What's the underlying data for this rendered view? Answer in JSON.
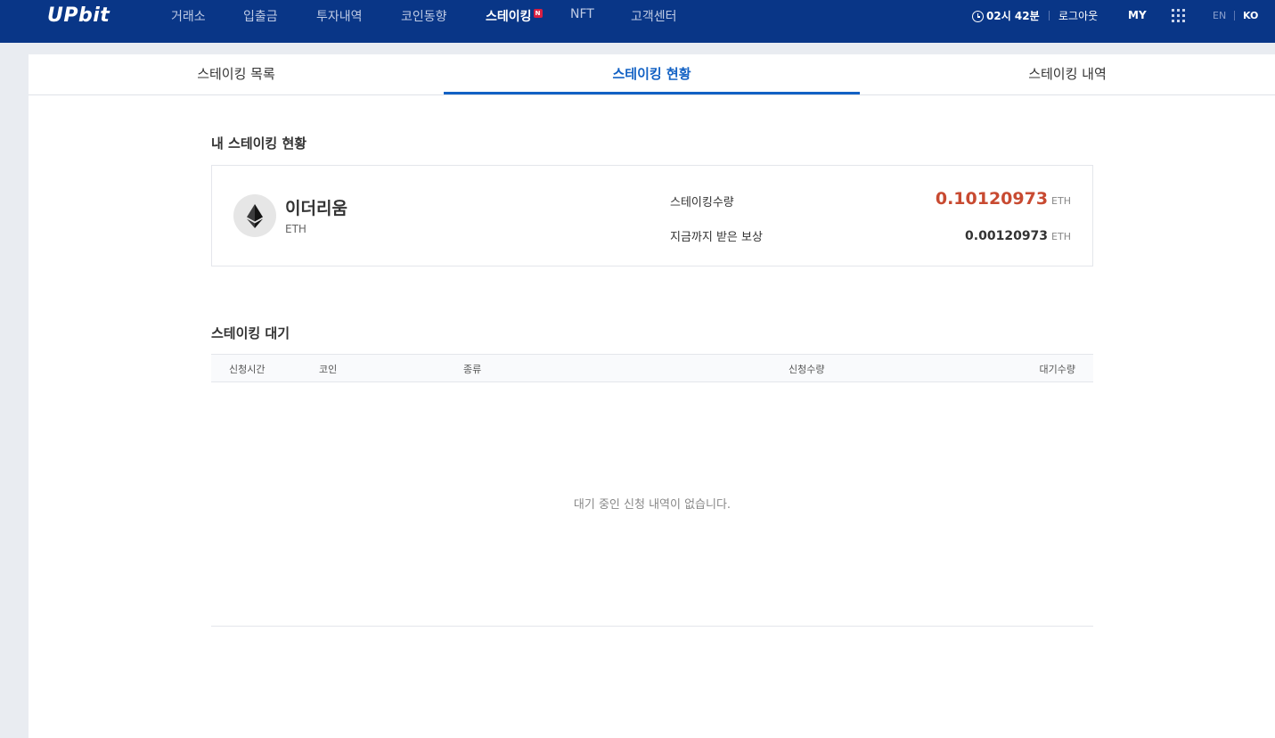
{
  "header": {
    "logo": "UPbit",
    "nav": [
      {
        "label": "거래소"
      },
      {
        "label": "입출금"
      },
      {
        "label": "투자내역"
      },
      {
        "label": "코인동향"
      },
      {
        "label": "스테이킹",
        "badge": "N",
        "active": true
      },
      {
        "label": "NFT"
      },
      {
        "label": "고객센터"
      }
    ],
    "clock": "02시 42분",
    "logout": "로그아웃",
    "my": "MY",
    "lang_en": "EN",
    "lang_ko": "KO"
  },
  "tabs": [
    {
      "label": "스테이킹 목록"
    },
    {
      "label": "스테이킹 현황",
      "active": true
    },
    {
      "label": "스테이킹 내역"
    }
  ],
  "my_staking": {
    "title": "내 스테이킹 현황",
    "coin": {
      "name": "이더리움",
      "symbol": "ETH",
      "icon": "ethereum-icon"
    },
    "staking_amount": {
      "label": "스테이킹수량",
      "value": "0.10120973",
      "unit": "ETH"
    },
    "rewards": {
      "label": "지금까지 받은 보상",
      "value": "0.00120973",
      "unit": "ETH"
    }
  },
  "pending": {
    "title": "스테이킹 대기",
    "columns": [
      "신청시간",
      "코인",
      "종류",
      "신청수량",
      "대기수량"
    ],
    "empty_message": "대기 중인 신청 내역이 없습니다."
  },
  "colors": {
    "header_bg": "#093687",
    "accent": "#1261c4",
    "value_red": "#c84a31"
  }
}
